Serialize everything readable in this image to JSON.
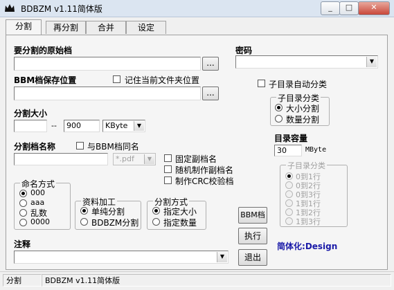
{
  "window": {
    "title": "BDBZM v1.11简体版",
    "min": "_",
    "max": "□",
    "close": "✕"
  },
  "tabs": [
    {
      "label": "分割"
    },
    {
      "label": "再分割"
    },
    {
      "label": "合并"
    },
    {
      "label": "设定"
    }
  ],
  "source": {
    "label": "要分割的原始档",
    "value": "",
    "browse": "..."
  },
  "password": {
    "label": "密码",
    "value": "",
    "arrow": "▼"
  },
  "save_location": {
    "label": "BBM档保存位置",
    "remember_label": "记住当前文件夹位置",
    "value": "",
    "browse": "..."
  },
  "auto_subdir": {
    "label": "子目录自动分类"
  },
  "subdir_group": {
    "title": "子目录分类",
    "options": [
      "大小分割",
      "数量分割"
    ]
  },
  "split_size": {
    "label": "分割大小",
    "from": "",
    "dash": "--",
    "to": "900",
    "unit": "KByte",
    "arrow": "▼"
  },
  "capacity": {
    "label": "目录容量",
    "value": "30",
    "unit": "MByte"
  },
  "subdir_group2": {
    "title": "子目录分类",
    "options": [
      "0到1行",
      "0到2行",
      "0到3行",
      "1到1行",
      "1到2行",
      "1到3行"
    ]
  },
  "filename": {
    "label": "分割档名称",
    "same_label": "与BBM档同名",
    "value": "",
    "ext": "*.pdf",
    "arrow": "▼"
  },
  "options": {
    "fixed_sub": "固定副档名",
    "random_sub": "随机制作副档名",
    "crc": "制作CRC校验档"
  },
  "naming": {
    "title": "命名方式",
    "options": [
      "000",
      "aaa",
      "乱数",
      "0000"
    ]
  },
  "processing": {
    "title": "资料加工",
    "options": [
      "单纯分割",
      "BDBZM分割"
    ]
  },
  "split_method": {
    "title": "分割方式",
    "options": [
      "指定大小",
      "指定数量"
    ]
  },
  "buttons": {
    "bbm": "BBM档",
    "execute": "执行",
    "exit": "退出"
  },
  "credit": {
    "prefix": "简体化:",
    "name": "Design"
  },
  "notes": {
    "label": "注释",
    "value": "",
    "arrow": "▼"
  },
  "status": {
    "mode": "分割",
    "version": "BDBZM v1.11简体版"
  },
  "colors": {
    "credit": "#1a1aa8"
  }
}
